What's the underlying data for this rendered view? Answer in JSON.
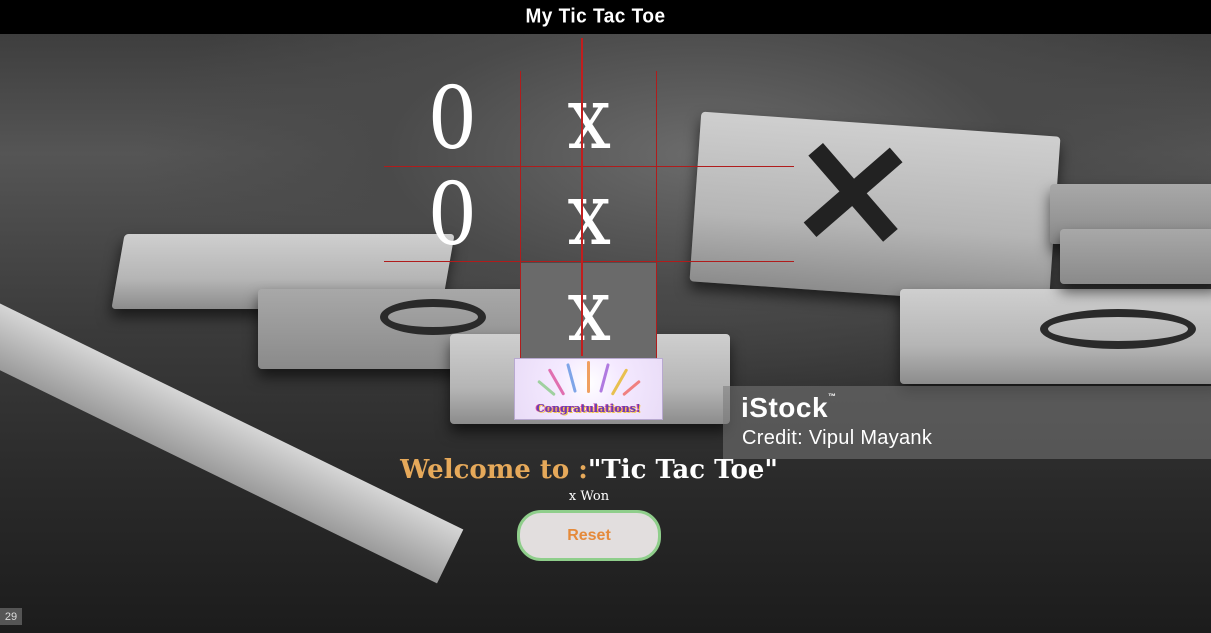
{
  "navbar": {
    "title": "My Tic Tac Toe"
  },
  "board": {
    "cells": [
      "0",
      "x",
      "",
      "0",
      "x",
      "",
      "",
      "x",
      ""
    ],
    "winning_cell_index": 7
  },
  "congrats": {
    "label": "Congratulations!"
  },
  "welcome": {
    "prefix": "Welcome to :",
    "game_name": "\"Tic Tac Toe\""
  },
  "status": {
    "text": "x Won"
  },
  "reset": {
    "label": "Reset"
  },
  "watermark": {
    "brand": "iStock",
    "trademark": "™",
    "credit": "Credit: Vipul Mayank"
  },
  "corner_tag": {
    "text": "29"
  },
  "colors": {
    "navbar_bg": "#000000",
    "grid_line": "#b01c1c",
    "win_cell_bg": "#6a6a6a",
    "welcome_prefix": "#e6a95a",
    "reset_text": "#e58a3a",
    "reset_border": "#8fce8b"
  }
}
